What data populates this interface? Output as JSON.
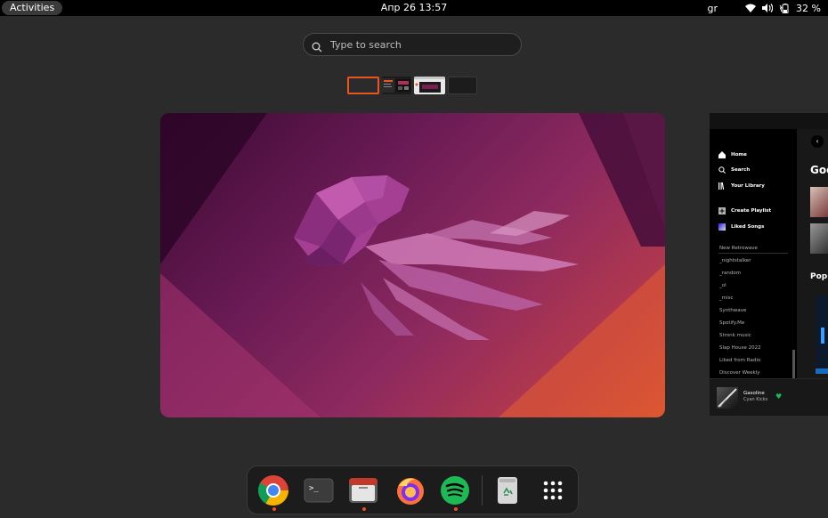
{
  "topbar": {
    "activities_label": "Activities",
    "clock": "Апр 26  13:57",
    "keyboard_layout": "gr",
    "battery_percent": "32 %",
    "icons": [
      "wifi-icon",
      "volume-icon",
      "battery-charging-icon"
    ]
  },
  "search": {
    "placeholder": "Type to search"
  },
  "workspaces": {
    "count": 4,
    "active_index": 0
  },
  "spotify_preview": {
    "nav": [
      "Home",
      "Search",
      "Your Library"
    ],
    "actions": [
      "Create Playlist",
      "Liked Songs"
    ],
    "playlists": [
      "New Retrowave",
      "_nightstalker",
      "_random",
      "_ol",
      "_misc",
      "Synthwave",
      "Spotify.Me",
      "Stronk music",
      "Slap House 2022",
      "Liked from Radio",
      "Discover Weekly"
    ],
    "main_heading": "Goo",
    "section_heading": "Popu",
    "now_playing": {
      "track": "Gasoline",
      "artist": "Cyan Kicks"
    }
  },
  "dock": {
    "apps": [
      {
        "name": "Google Chrome",
        "icon": "chrome-icon",
        "running": true
      },
      {
        "name": "Terminal",
        "icon": "terminal-icon",
        "running": false
      },
      {
        "name": "Files",
        "icon": "files-icon",
        "running": true
      },
      {
        "name": "Firefox",
        "icon": "firefox-icon",
        "running": false
      },
      {
        "name": "Spotify",
        "icon": "spotify-icon",
        "running": true
      },
      {
        "name": "Trash",
        "icon": "trash-icon",
        "running": false
      },
      {
        "name": "Show Applications",
        "icon": "app-grid-icon",
        "running": false
      }
    ]
  },
  "colors": {
    "accent": "#e95420",
    "spotify_green": "#1db954",
    "background": "#2b2b2b"
  }
}
